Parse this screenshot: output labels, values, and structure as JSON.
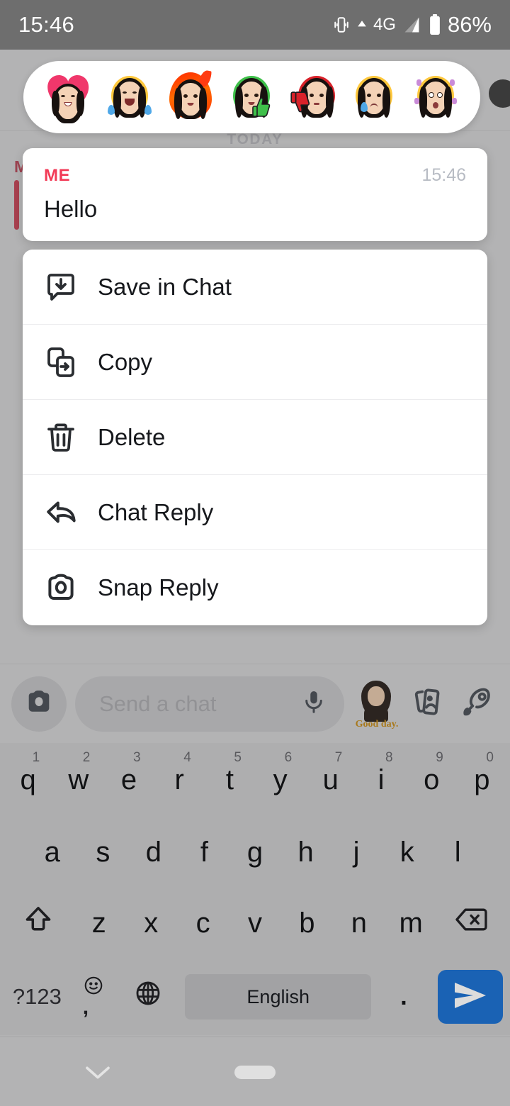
{
  "status_bar": {
    "time": "15:46",
    "network": "4G",
    "battery": "86%",
    "icons": [
      "vibrate-icon",
      "signal-up-icon",
      "signal-bars-icon",
      "battery-icon"
    ]
  },
  "reactions": {
    "items": [
      {
        "name": "heart-reaction",
        "emoji": "heart"
      },
      {
        "name": "laughing-reaction",
        "emoji": "joy"
      },
      {
        "name": "fire-reaction",
        "emoji": "fire"
      },
      {
        "name": "thumbs-up-reaction",
        "emoji": "thumbs-up"
      },
      {
        "name": "thumbs-down-reaction",
        "emoji": "thumbs-down"
      },
      {
        "name": "sad-reaction",
        "emoji": "cry"
      },
      {
        "name": "wow-reaction",
        "emoji": "surprised"
      }
    ]
  },
  "chat": {
    "day_divider": "TODAY",
    "behind_label": "M",
    "message": {
      "sender": "ME",
      "time": "15:46",
      "text": "Hello"
    }
  },
  "context_menu": {
    "items": [
      {
        "label": "Save in Chat",
        "icon": "save-in-chat-icon"
      },
      {
        "label": "Copy",
        "icon": "copy-icon"
      },
      {
        "label": "Delete",
        "icon": "trash-icon"
      },
      {
        "label": "Chat Reply",
        "icon": "reply-arrow-icon"
      },
      {
        "label": "Snap Reply",
        "icon": "camera-icon"
      }
    ]
  },
  "input_bar": {
    "camera_icon": "camera-icon",
    "placeholder": "Send a chat",
    "mic_icon": "microphone-icon",
    "bitmoji_sticker_text": "Good day.",
    "stickers_icon": "stickers-icon",
    "rocket_icon": "rocket-icon"
  },
  "keyboard": {
    "row1": [
      {
        "key": "q",
        "num": "1"
      },
      {
        "key": "w",
        "num": "2"
      },
      {
        "key": "e",
        "num": "3"
      },
      {
        "key": "r",
        "num": "4"
      },
      {
        "key": "t",
        "num": "5"
      },
      {
        "key": "y",
        "num": "6"
      },
      {
        "key": "u",
        "num": "7"
      },
      {
        "key": "i",
        "num": "8"
      },
      {
        "key": "o",
        "num": "9"
      },
      {
        "key": "p",
        "num": "0"
      }
    ],
    "row2": [
      "a",
      "s",
      "d",
      "f",
      "g",
      "h",
      "j",
      "k",
      "l"
    ],
    "row3": [
      "z",
      "x",
      "c",
      "v",
      "b",
      "n",
      "m"
    ],
    "shift_icon": "shift-icon",
    "backspace_icon": "backspace-icon",
    "symbols_key": "?123",
    "emoji_key_comma": ",",
    "emoji_icon": "emoji-icon",
    "language_icon": "globe-icon",
    "space_label": "English",
    "period_key": ".",
    "send_icon": "send-icon",
    "accent_color": "#1a62b4"
  },
  "nav_bar": {
    "hide_keyboard_icon": "chevron-down-icon",
    "home_indicator": "home-pill"
  },
  "colors": {
    "sender_red": "#f23b57",
    "dim_background": "#b3b3b4",
    "card_white": "#ffffff",
    "keyboard_bg": "#aeaeaf",
    "send_blue": "#1a62b4"
  }
}
